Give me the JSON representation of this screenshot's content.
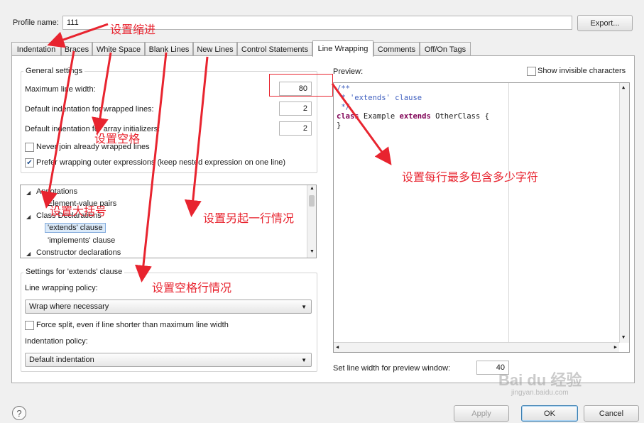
{
  "profile": {
    "label": "Profile name:",
    "value": "111"
  },
  "export_label": "Export...",
  "tabs": [
    {
      "label": "Indentation"
    },
    {
      "label": "Braces"
    },
    {
      "label": "White Space"
    },
    {
      "label": "Blank Lines"
    },
    {
      "label": "New Lines"
    },
    {
      "label": "Control Statements"
    },
    {
      "label": "Line Wrapping"
    },
    {
      "label": "Comments"
    },
    {
      "label": "Off/On Tags"
    }
  ],
  "active_tab": "Line Wrapping",
  "general": {
    "title": "General settings",
    "max_width_label": "Maximum line width:",
    "max_width_value": "80",
    "wrapped_indent_label": "Default indentation for wrapped lines:",
    "wrapped_indent_value": "2",
    "array_indent_label": "Default indentation for array initializers:",
    "array_indent_value": "2",
    "never_join_label": "Never join already wrapped lines",
    "never_join_checked": false,
    "prefer_outer_label": "Prefer wrapping outer expressions (keep nested expression on one line)",
    "prefer_outer_checked": true
  },
  "tree": {
    "annotations": "Annotations",
    "element_value_pairs": "Element-value pairs",
    "class_declarations": "Class Declarations",
    "extends_clause": "'extends' clause",
    "implements_clause": "'implements' clause",
    "constructor_declarations": "Constructor declarations"
  },
  "settings": {
    "title": "Settings for 'extends' clause",
    "policy_label": "Line wrapping policy:",
    "policy_value": "Wrap where necessary",
    "force_split_label": "Force split, even if line shorter than maximum line width",
    "force_split_checked": false,
    "indent_policy_label": "Indentation policy:",
    "indent_policy_value": "Default indentation"
  },
  "preview": {
    "label": "Preview:",
    "show_invisible_label": "Show invisible characters",
    "show_invisible_checked": false,
    "code": {
      "l1": "/**",
      "l2": " * 'extends' clause",
      "l3": " */",
      "kw_class": "class",
      "name": " Example ",
      "kw_extends": "extends",
      "rest": " OtherClass {",
      "l5": "}"
    },
    "width_label": "Set line width for preview window:",
    "width_value": "40"
  },
  "buttons": {
    "apply": "Apply",
    "ok": "OK",
    "cancel": "Cancel",
    "help": "?"
  },
  "annotations": {
    "a1": "设置缩进",
    "a2": "设置空格",
    "a3": "设置大括号",
    "a4": "设置另起一行情况",
    "a5": "设置空格行情况",
    "a6": "设置每行最多包含多少字符"
  },
  "watermark": {
    "brand": "Bai du 经验",
    "url": "jingyan.baidu.com"
  },
  "colors": {
    "annotation_red": "#e8242f",
    "selection": "#dbeaf9",
    "keyword": "#7f0055",
    "comment": "#3f5fbf"
  }
}
